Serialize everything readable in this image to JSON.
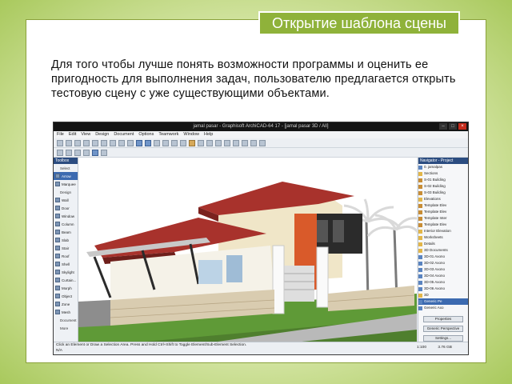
{
  "slide": {
    "title": "Открытие шаблона сцены",
    "body": "Для того чтобы лучше понять возможности программы и оценить ее пригодность для выполнения задач, пользователю предлагается открыть тестовую сцену с уже существующими объектами."
  },
  "colors": {
    "accent": "#8fb23a",
    "frame_border": "#8aa23a"
  },
  "app": {
    "window_title": "jamal pasar - Graphisoft ArchiCAD-64 17 - [jamal pasar 3D / All]",
    "menus": [
      "File",
      "Edit",
      "View",
      "Design",
      "Document",
      "Options",
      "Teamwork",
      "Window",
      "Help"
    ],
    "toolbox": {
      "title": "Toolbox",
      "items": [
        "Select",
        "Arrow",
        "Marquee",
        "Design",
        "Wall",
        "Door",
        "Window",
        "Column",
        "Beam",
        "Slab",
        "Stair",
        "Roof",
        "Shell",
        "Skylight",
        "Curtain...",
        "Morph",
        "Object",
        "Zone",
        "Mesh",
        "Document",
        "More"
      ]
    },
    "navigator": {
      "title": "Navigator - Project",
      "items": [
        "0. jamalpas",
        "Sections",
        "S-01 Building",
        "S-02 Building",
        "S-03 Building",
        "Elevations",
        "Template Elev",
        "Template Elev",
        "Template Inter",
        "Template Elev",
        "Interior Elevation",
        "Worksheets",
        "Details",
        "3D Documents",
        "3D-01 Axono",
        "3D-02 Axono",
        "3D-03 Axono",
        "3D-04 Axono",
        "3D-05 Axono",
        "3D-06 Axono",
        "3D",
        "Generic Pe",
        "Generic Axo"
      ],
      "btn_properties": "Properties",
      "btn_perspective": "Generic Perspective",
      "btn_settings": "Settings..."
    },
    "status": {
      "hint": "Click an Element or Draw a Selection Area. Press and Hold Ctrl+Shift to Toggle Element/Sub-Element Selection.",
      "zoom": "N/A",
      "scale": "1:100",
      "size": "3.76 GB"
    }
  }
}
